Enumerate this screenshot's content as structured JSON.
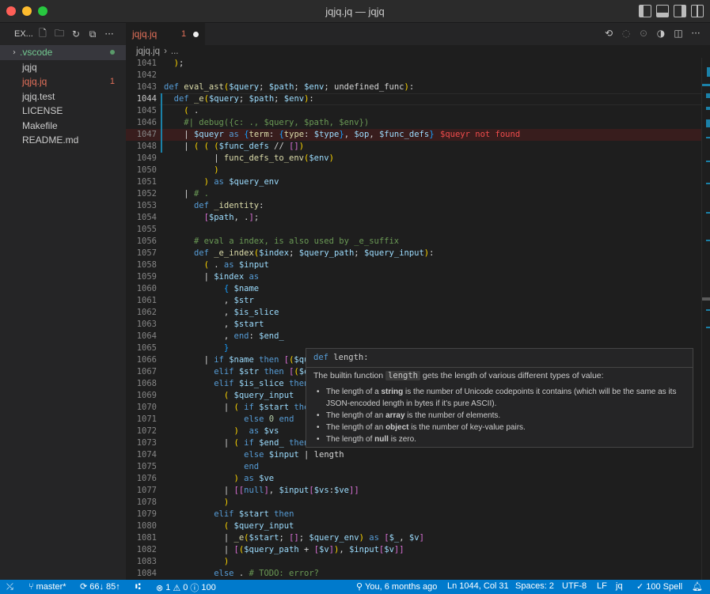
{
  "window": {
    "title": "jqjq.jq — jqjq"
  },
  "explorer": {
    "header": "EX...",
    "items": [
      {
        "label": ".vscode",
        "kind": "folder"
      },
      {
        "label": "jqjq",
        "kind": "file"
      },
      {
        "label": "jqjq.jq",
        "kind": "file",
        "badge": "1"
      },
      {
        "label": "jqjq.test",
        "kind": "file"
      },
      {
        "label": "LICENSE",
        "kind": "file"
      },
      {
        "label": "Makefile",
        "kind": "file"
      },
      {
        "label": "README.md",
        "kind": "file"
      }
    ]
  },
  "tab": {
    "label": "jqjq.jq",
    "count": "1"
  },
  "breadcrumb": {
    "file": "jqjq.jq",
    "rest": "..."
  },
  "editor": {
    "lines": [
      {
        "n": "1041",
        "text": "  );"
      },
      {
        "n": "1042",
        "text": ""
      },
      {
        "n": "1043",
        "text": "def eval_ast($query; $path; $env; undefined_func):"
      },
      {
        "n": "1044",
        "text": "  def _e($query; $path; $env):"
      },
      {
        "n": "1045",
        "text": "    ( ."
      },
      {
        "n": "1046",
        "text": "    #| debug({c: ., $query, $path, $env})"
      },
      {
        "n": "1047",
        "text": "    | $queyr as {term: {type: $type}, $op, $func_defs}"
      },
      {
        "n": "1048",
        "text": "    | ( ( ($func_defs // [])"
      },
      {
        "n": "1049",
        "text": "          | func_defs_to_env($env)"
      },
      {
        "n": "1050",
        "text": "          )"
      },
      {
        "n": "1051",
        "text": "        ) as $query_env"
      },
      {
        "n": "1052",
        "text": "    | # ."
      },
      {
        "n": "1053",
        "text": "      def _identity:"
      },
      {
        "n": "1054",
        "text": "        [$path, .];"
      },
      {
        "n": "1055",
        "text": ""
      },
      {
        "n": "1056",
        "text": "      # eval a index, is also used by _e_suffix"
      },
      {
        "n": "1057",
        "text": "      def _e_index($index; $query_path; $query_input):"
      },
      {
        "n": "1058",
        "text": "        ( . as $input"
      },
      {
        "n": "1059",
        "text": "        | $index as"
      },
      {
        "n": "1060",
        "text": "            { $name"
      },
      {
        "n": "1061",
        "text": "            , $str"
      },
      {
        "n": "1062",
        "text": "            , $is_slice"
      },
      {
        "n": "1063",
        "text": "            , $start"
      },
      {
        "n": "1064",
        "text": "            , end: $end_"
      },
      {
        "n": "1065",
        "text": "            }"
      },
      {
        "n": "1066",
        "text": "        | if $name then [($que"
      },
      {
        "n": "1067",
        "text": "          elif $str then [($qu"
      },
      {
        "n": "1068",
        "text": "          elif $is_slice then"
      },
      {
        "n": "1069",
        "text": "            ( $query_input"
      },
      {
        "n": "1070",
        "text": "            | ( if $start then"
      },
      {
        "n": "1071",
        "text": "                else 0 end"
      },
      {
        "n": "1072",
        "text": "              )  as $vs"
      },
      {
        "n": "1073",
        "text": "            | ( if $end_ then"
      },
      {
        "n": "1074",
        "text": "                else $input | length"
      },
      {
        "n": "1075",
        "text": "                end"
      },
      {
        "n": "1076",
        "text": "              ) as $ve"
      },
      {
        "n": "1077",
        "text": "            | [[null], $input[$vs:$ve]]"
      },
      {
        "n": "1078",
        "text": "            )"
      },
      {
        "n": "1079",
        "text": "          elif $start then"
      },
      {
        "n": "1080",
        "text": "            ( $query_input"
      },
      {
        "n": "1081",
        "text": "            | _e($start; []; $query_env) as [$_, $v]"
      },
      {
        "n": "1082",
        "text": "            | [($query_path + [$v]), $input[$v]]"
      },
      {
        "n": "1083",
        "text": "            )"
      },
      {
        "n": "1084",
        "text": "          else . # TODO: error?"
      }
    ],
    "error_message": "$queyr not found"
  },
  "hover": {
    "signature_kw": "def",
    "signature_name": "length:",
    "desc_before": "The builtin function",
    "desc_code": "length",
    "desc_after": "gets the length of various different types of value:",
    "bullets": [
      {
        "pre": "The length of a ",
        "bold": "string",
        "post": " is the number of Unicode codepoints it contains (which will be the same as its JSON-encoded length in bytes if it's pure ASCII)."
      },
      {
        "pre": "The length of an ",
        "bold": "array",
        "post": " is the number of elements."
      },
      {
        "pre": "The length of an ",
        "bold": "object",
        "post": " is the number of key-value pairs."
      },
      {
        "pre": "The length of ",
        "bold": "null",
        "post": " is zero."
      }
    ]
  },
  "statusbar": {
    "branch": "master*",
    "sync": "66↓ 85↑",
    "problems_errors": "1",
    "problems_warnings": "0",
    "ports": "100",
    "blame": "You, 6 months ago",
    "position": "Ln 1044, Col 31",
    "indent": "Spaces: 2",
    "encoding": "UTF-8",
    "eol": "LF",
    "language": "jq",
    "spell": "100 Spell"
  },
  "colors": {
    "accent": "#007acc",
    "error": "#f14c4c",
    "modified": "#e2705a",
    "untracked": "#73c991"
  }
}
